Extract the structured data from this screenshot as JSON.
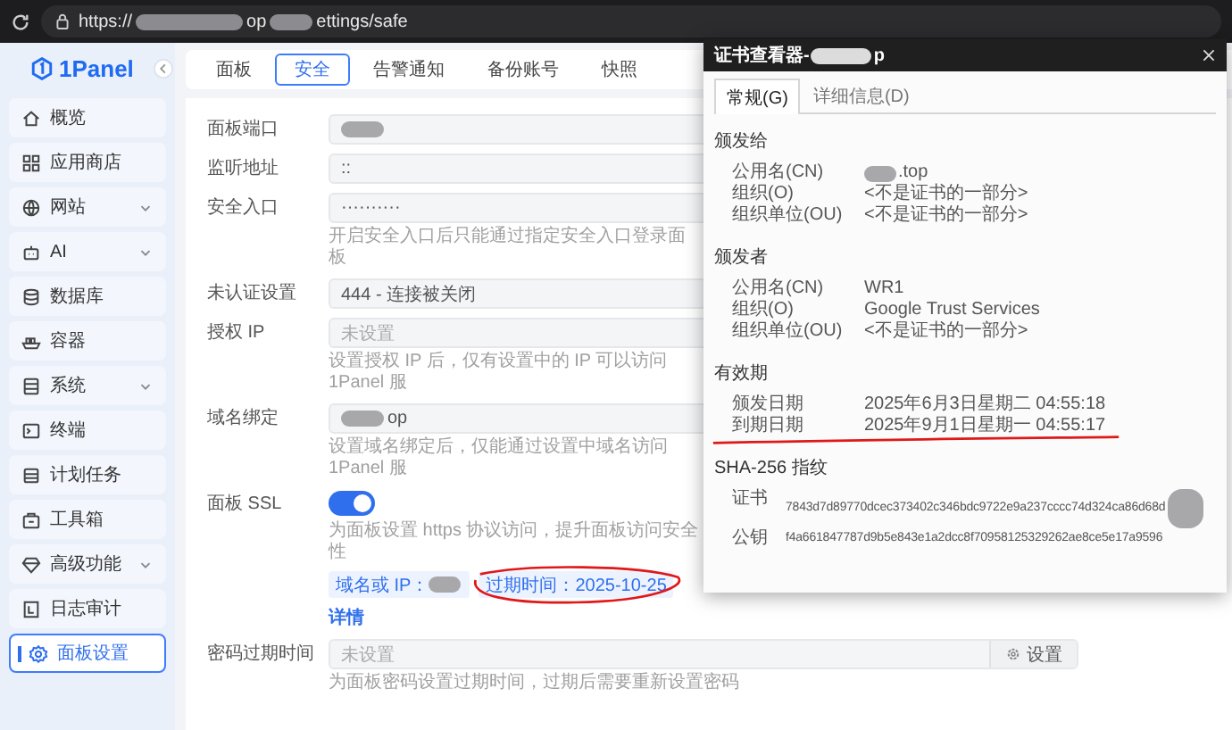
{
  "browser": {
    "url_prefix": "https://",
    "url_middle": "op",
    "url_suffix": "ettings/safe"
  },
  "logo": "1Panel",
  "sidebar": {
    "items": [
      {
        "label": "概览",
        "expandable": false,
        "selected": false
      },
      {
        "label": "应用商店",
        "expandable": false,
        "selected": false
      },
      {
        "label": "网站",
        "expandable": true,
        "selected": false
      },
      {
        "label": "AI",
        "expandable": true,
        "selected": false
      },
      {
        "label": "数据库",
        "expandable": false,
        "selected": false
      },
      {
        "label": "容器",
        "expandable": false,
        "selected": false
      },
      {
        "label": "系统",
        "expandable": true,
        "selected": false
      },
      {
        "label": "终端",
        "expandable": false,
        "selected": false
      },
      {
        "label": "计划任务",
        "expandable": false,
        "selected": false
      },
      {
        "label": "工具箱",
        "expandable": false,
        "selected": false
      },
      {
        "label": "高级功能",
        "expandable": true,
        "selected": false
      },
      {
        "label": "日志审计",
        "expandable": false,
        "selected": false
      },
      {
        "label": "面板设置",
        "expandable": false,
        "selected": true
      }
    ]
  },
  "tabs": [
    {
      "label": "面板",
      "selected": false
    },
    {
      "label": "安全",
      "selected": true
    },
    {
      "label": "告警通知",
      "selected": false
    },
    {
      "label": "备份账号",
      "selected": false
    },
    {
      "label": "快照",
      "selected": false
    }
  ],
  "form": {
    "rows": [
      {
        "kind": "field",
        "label": "面板端口",
        "redacted": true
      },
      {
        "kind": "field",
        "label": "监听地址",
        "value": "::"
      },
      {
        "kind": "field",
        "label": "安全入口",
        "value": "··········",
        "hint": "开启安全入口后只能通过指定安全入口登录面板"
      },
      {
        "kind": "field",
        "label": "未认证设置",
        "value": "444 - 连接被关闭"
      },
      {
        "kind": "field",
        "label": "授权 IP",
        "placeholder": "未设置",
        "hint": "设置授权 IP 后，仅有设置中的 IP 可以访问 1Panel 服"
      },
      {
        "kind": "field",
        "label": "域名绑定",
        "redacted": true,
        "value": "op",
        "hint": "设置域名绑定后，仅能通过设置中域名访问 1Panel 服"
      },
      {
        "kind": "switch",
        "label": "面板 SSL",
        "on": true,
        "hint": "为面板设置 https 协议访问，提升面板访问安全性",
        "tags": [
          {
            "label": "域名或 IP：",
            "redacted": true,
            "circled": false
          },
          {
            "label": "过期时间：2025-10-25",
            "redacted": false,
            "circled": true
          }
        ],
        "link": "详情"
      },
      {
        "kind": "field",
        "label": "密码过期时间",
        "placeholder": "未设置",
        "button": "设置",
        "hint": "为面板密码设置过期时间，过期后需要重新设置密码"
      }
    ]
  },
  "dialog": {
    "title": "证书查看器-",
    "title_end": "p",
    "tabs": [
      {
        "label": "常规(G)",
        "selected": true
      },
      {
        "label": "详细信息(D)",
        "selected": false
      }
    ],
    "sections": [
      {
        "heading": "颁发给",
        "kind": "text",
        "rows": [
          {
            "label": "公用名(CN)",
            "value": ".top",
            "redacted": true
          },
          {
            "label": "组织(O)",
            "value": "<不是证书的一部分>"
          },
          {
            "label": "组织单位(OU)",
            "value": "<不是证书的一部分>"
          }
        ]
      },
      {
        "heading": "颁发者",
        "kind": "text",
        "rows": [
          {
            "label": "公用名(CN)",
            "value": "WR1"
          },
          {
            "label": "组织(O)",
            "value": "Google Trust Services"
          },
          {
            "label": "组织单位(OU)",
            "value": "<不是证书的一部分>"
          }
        ]
      },
      {
        "heading": "有效期",
        "kind": "text",
        "rows": [
          {
            "label": "颁发日期",
            "value": "2025年6月3日星期二 04:55:18"
          },
          {
            "label": "到期日期",
            "value": "2025年9月1日星期一 04:55:17",
            "underlined": true
          }
        ]
      },
      {
        "heading": "SHA-256 指纹",
        "kind": "hash",
        "rows": [
          {
            "label": "证书",
            "value": "7843d7d89770dcec373402c346bdc9722e9a237cccc74d324ca86d68d",
            "blot_after": true
          },
          {
            "label": "公钥",
            "value": "f4a661847787d9b5e843e1a2dcc8f70958125329262ae8ce5e17a9596"
          }
        ]
      }
    ]
  }
}
